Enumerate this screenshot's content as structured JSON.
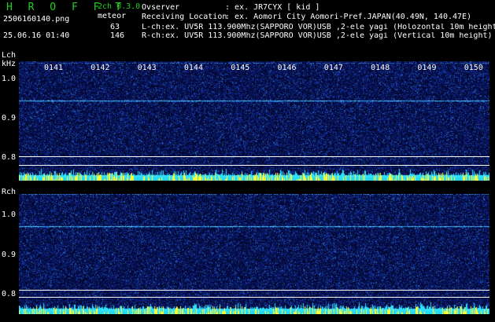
{
  "header": {
    "app_title": "H R O F F T",
    "mode": "2ch 0.3.0",
    "filename": "2506160140.png",
    "meteor_label": "meteor",
    "datetime": "25.06.16 01:40",
    "count_l": "63",
    "count_r": "146",
    "observer_label": "Ovserver",
    "observer_value": ": ex. JR7CYX [ kid ]",
    "location_label": "Receiving Location",
    "location_value": ": ex. Aomori City Aomori-Pref.JAPAN(40.49N, 140.47E)",
    "lch_desc": "L-ch:ex. UV5R 113.900Mhz(SAPPORO VOR)USB ,2-ele yagi (Holozontal 10m height",
    "rch_desc": "R-ch:ex. UV5R 113.900Mhz(SAPPORO VOR)USB ,2-ele yagi (Vertical 10m height)"
  },
  "lch": {
    "label": "Lch",
    "unit": "kHz",
    "yticks": [
      "1.0",
      "0.9",
      "0.8"
    ]
  },
  "rch": {
    "label": "Rch",
    "yticks": [
      "1.0",
      "0.9",
      "0.8"
    ]
  },
  "time_labels": [
    "0141",
    "0142",
    "0143",
    "0144",
    "0145",
    "0146",
    "0147",
    "0148",
    "0149",
    "0150"
  ],
  "colors": {
    "background": "#000000",
    "noise_base": "#0a1a7a",
    "carrier": "#40c0ff",
    "activity_low": "#30e0ff",
    "activity_high": "#ffff20",
    "header_green": "#1fd01f",
    "header_white": "#ffffff"
  }
}
